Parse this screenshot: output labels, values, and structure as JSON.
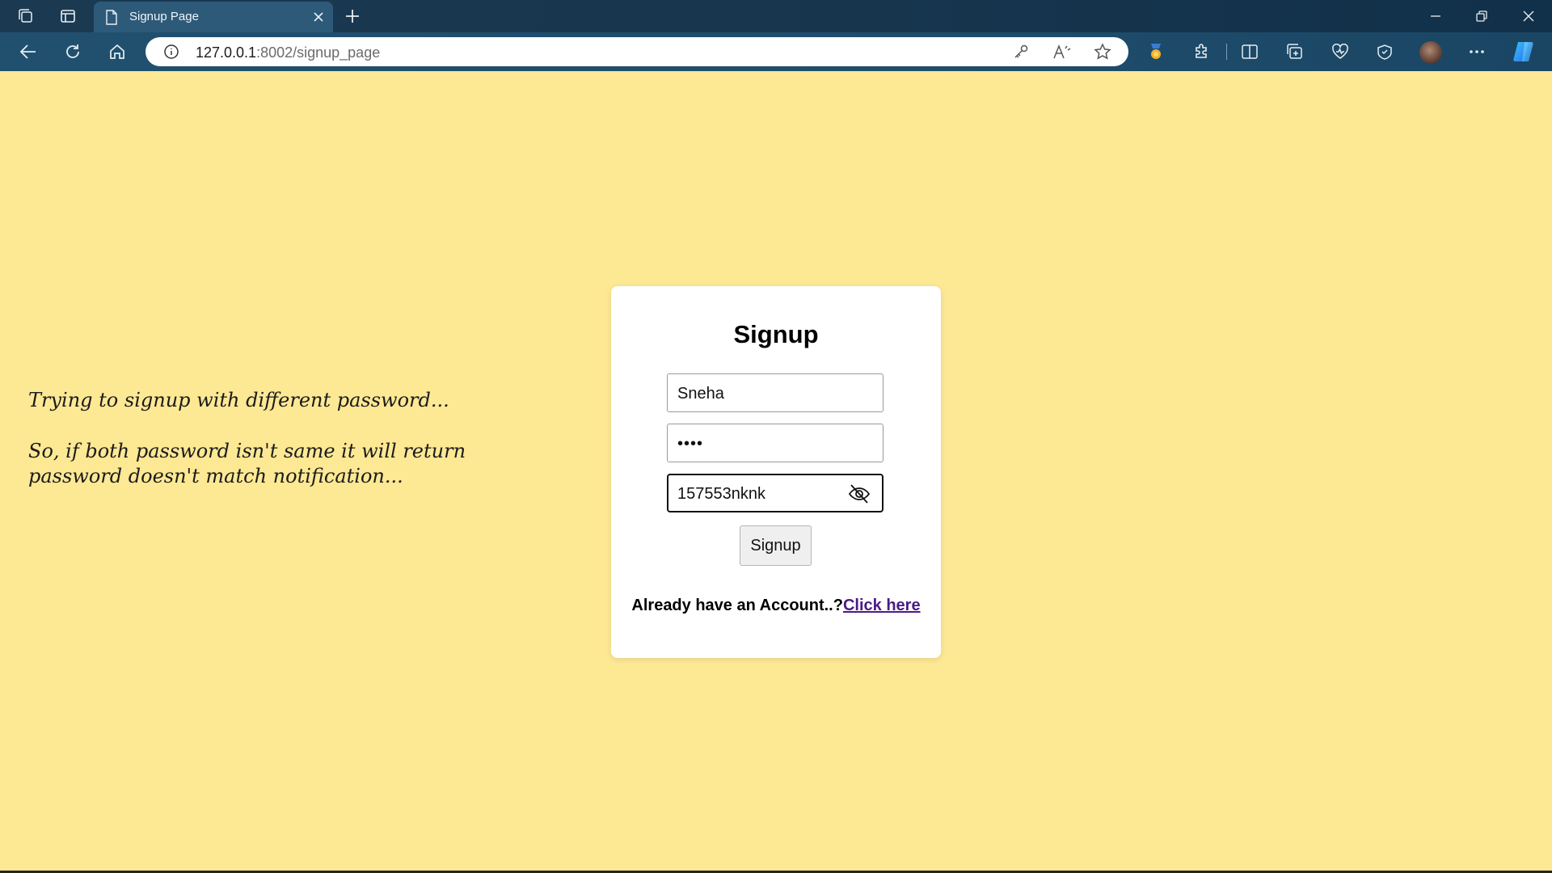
{
  "browser": {
    "tab_title": "Signup Page",
    "url_host": "127.0.0.1",
    "url_path": ":8002/signup_page",
    "icons": [
      "workspaces-icon",
      "tab-actions-icon",
      "page-icon",
      "close-tab-icon",
      "new-tab-icon",
      "back-icon",
      "refresh-icon",
      "home-icon",
      "info-icon",
      "key-icon",
      "read-aloud-icon",
      "favorite-star-icon",
      "rewards-icon",
      "extensions-icon",
      "split-screen-icon",
      "collections-icon",
      "browser-essentials-icon",
      "performance-icon",
      "profile-avatar",
      "more-icon",
      "copilot-icon",
      "minimize-icon",
      "restore-icon",
      "close-window-icon"
    ]
  },
  "note": {
    "line1": "Trying to signup with different password...",
    "line2": "So, if  both password isn't same it will return password doesn't match notification..."
  },
  "form": {
    "title": "Signup",
    "username_value": "Sneha",
    "password_dots": "••••",
    "confirm_value": "157553nknk",
    "submit_label": "Signup",
    "login_prompt": "Already have an Account..?",
    "login_link": "Click here"
  },
  "colors": {
    "page_background": "#fde894",
    "link": "#4a1b86"
  }
}
